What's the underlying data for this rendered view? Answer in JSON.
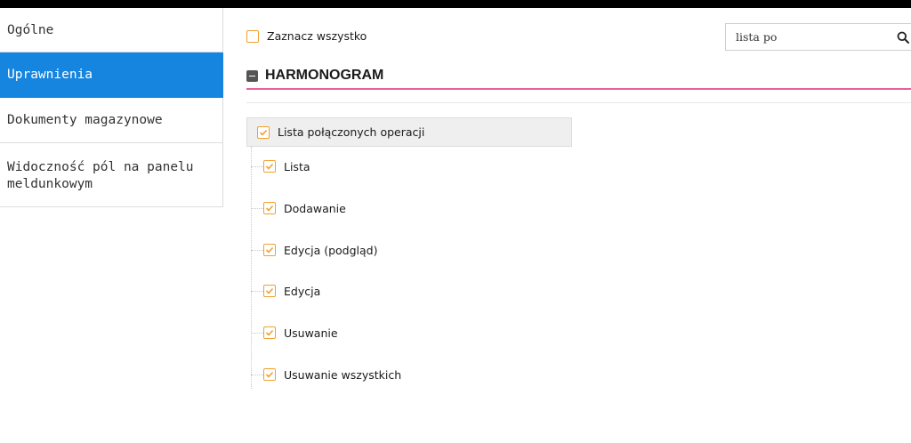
{
  "sidebar": {
    "items": [
      {
        "label": "Ogólne",
        "active": false
      },
      {
        "label": "Uprawnienia",
        "active": true
      },
      {
        "label": "Dokumenty magazynowe",
        "active": false
      },
      {
        "label": "Widoczność pól na panelu meldunkowym",
        "active": false
      }
    ]
  },
  "toolbar": {
    "select_all_label": "Zaznacz wszystko",
    "select_all_checked": false
  },
  "search": {
    "value": "lista po",
    "icon": "search-icon"
  },
  "section": {
    "title": "HARMONOGRAM",
    "icon": "collapse-icon"
  },
  "permission_group": {
    "label": "Lista połączonych operacji",
    "checked": true,
    "items": [
      {
        "label": "Lista",
        "checked": true
      },
      {
        "label": "Dodawanie",
        "checked": true
      },
      {
        "label": "Edycja (podgląd)",
        "checked": true
      },
      {
        "label": "Edycja",
        "checked": true
      },
      {
        "label": "Usuwanie",
        "checked": true
      },
      {
        "label": "Usuwanie wszystkich",
        "checked": true
      }
    ]
  },
  "colors": {
    "accent": "#1685e0",
    "checkbox": "#f0a030",
    "section_rule": "#e8609a"
  }
}
